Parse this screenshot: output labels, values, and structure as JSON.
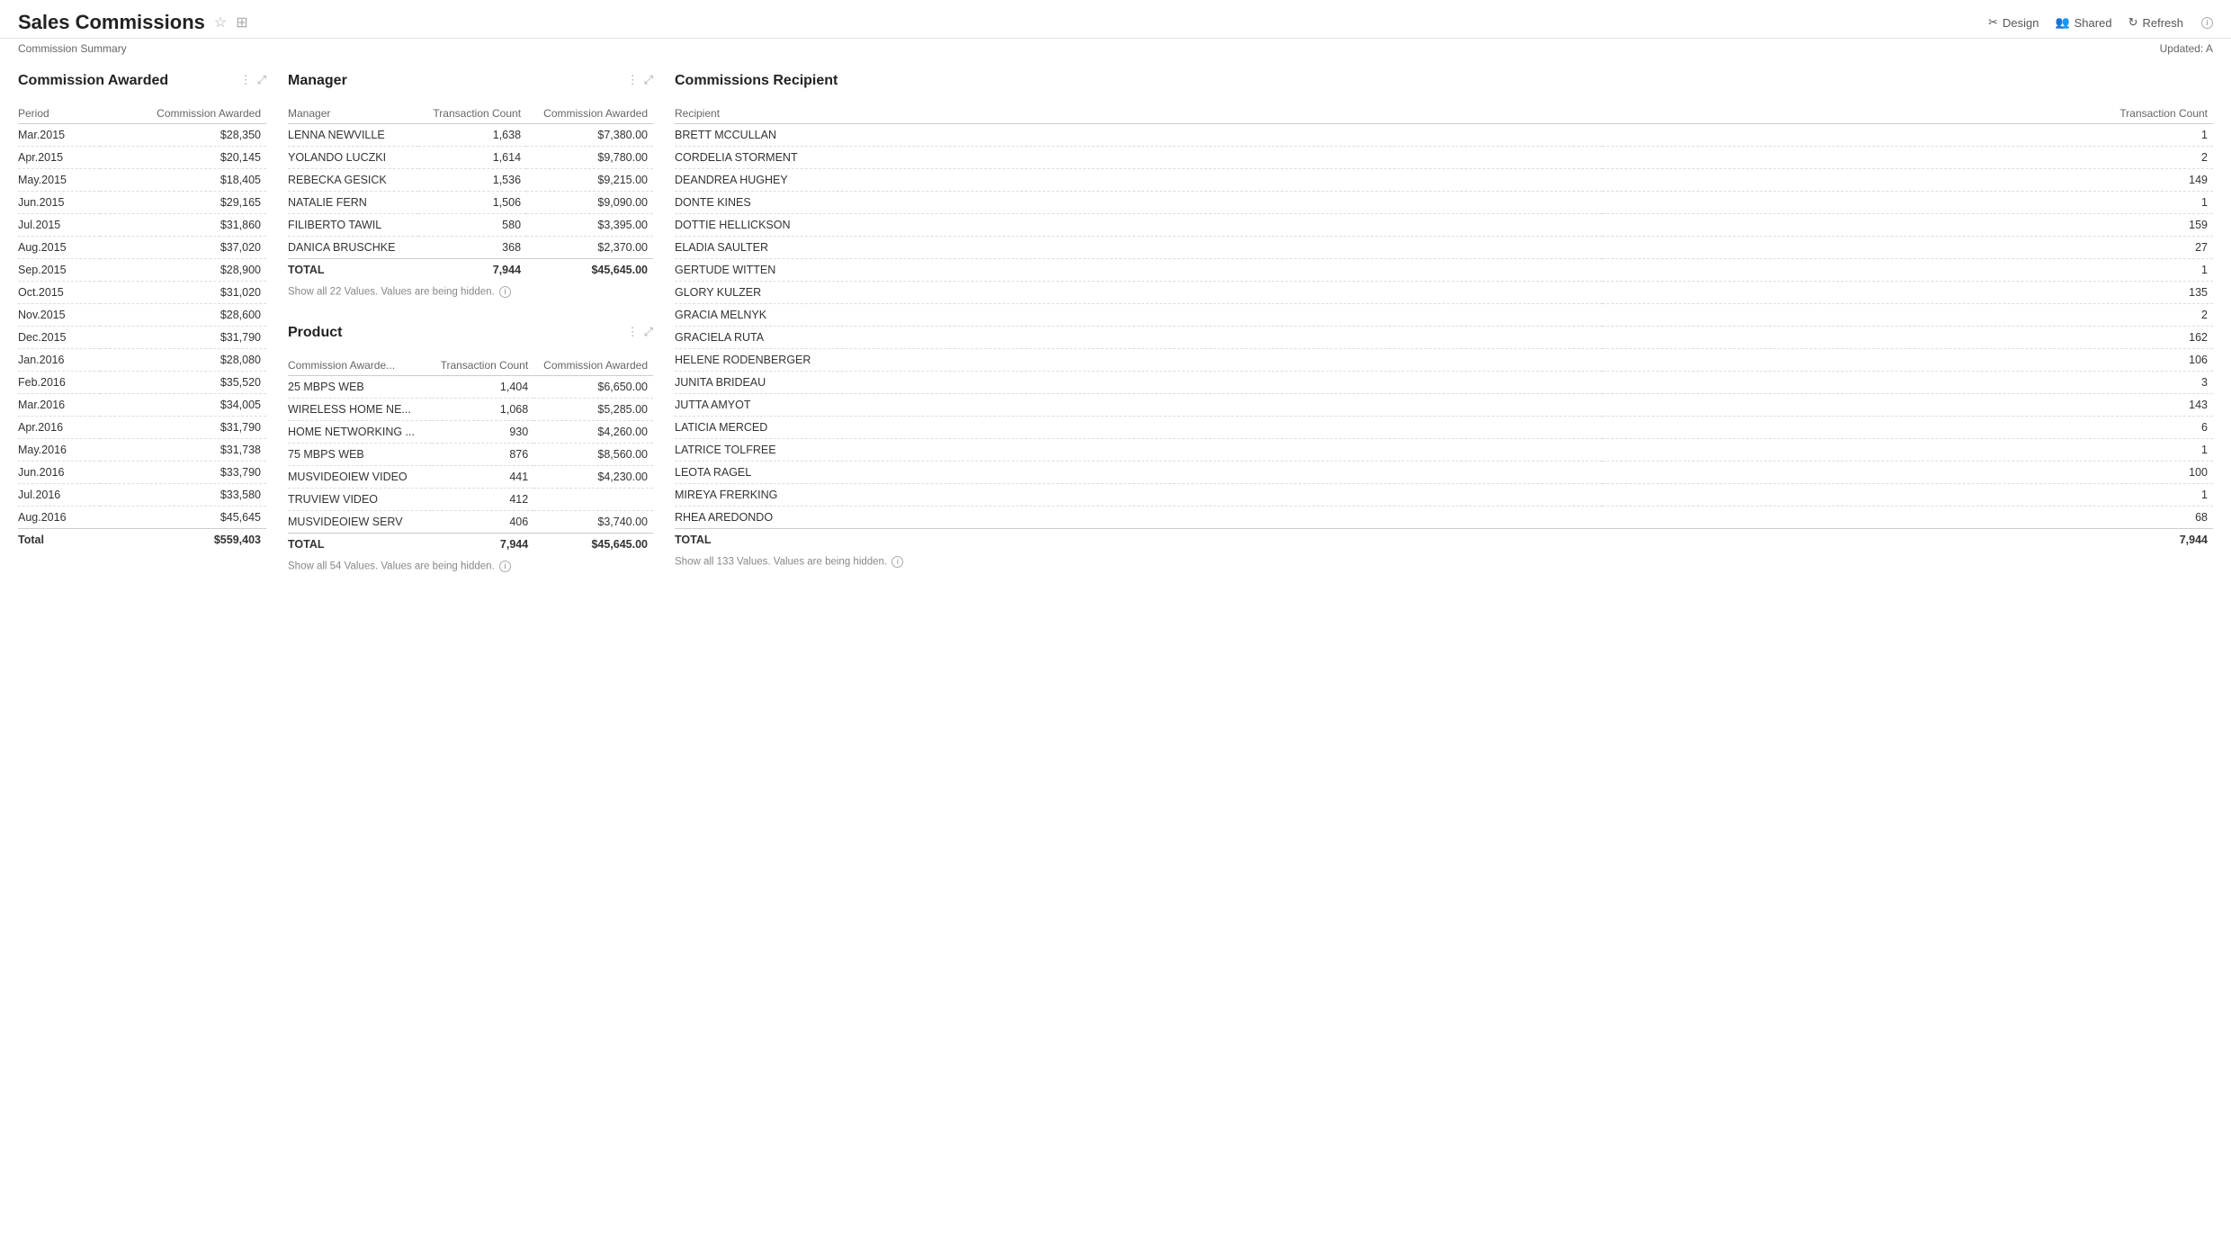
{
  "header": {
    "title": "Sales Commissions",
    "subtitle": "Commission Summary",
    "updated": "Updated: A",
    "actions": {
      "design": "Design",
      "shared": "Shared",
      "refresh": "Refresh"
    }
  },
  "commission_awarded": {
    "title": "Commission Awarded",
    "columns": [
      "Period",
      "Commission Awarded"
    ],
    "rows": [
      {
        "period": "Mar.2015",
        "amount": "$28,350"
      },
      {
        "period": "Apr.2015",
        "amount": "$20,145"
      },
      {
        "period": "May.2015",
        "amount": "$18,405"
      },
      {
        "period": "Jun.2015",
        "amount": "$29,165"
      },
      {
        "period": "Jul.2015",
        "amount": "$31,860"
      },
      {
        "period": "Aug.2015",
        "amount": "$37,020"
      },
      {
        "period": "Sep.2015",
        "amount": "$28,900"
      },
      {
        "period": "Oct.2015",
        "amount": "$31,020"
      },
      {
        "period": "Nov.2015",
        "amount": "$28,600"
      },
      {
        "period": "Dec.2015",
        "amount": "$31,790"
      },
      {
        "period": "Jan.2016",
        "amount": "$28,080"
      },
      {
        "period": "Feb.2016",
        "amount": "$35,520"
      },
      {
        "period": "Mar.2016",
        "amount": "$34,005"
      },
      {
        "period": "Apr.2016",
        "amount": "$31,790"
      },
      {
        "period": "May.2016",
        "amount": "$31,738"
      },
      {
        "period": "Jun.2016",
        "amount": "$33,790"
      },
      {
        "period": "Jul.2016",
        "amount": "$33,580"
      },
      {
        "period": "Aug.2016",
        "amount": "$45,645"
      }
    ],
    "total": {
      "period": "Total",
      "amount": "$559,403"
    }
  },
  "manager": {
    "title": "Manager",
    "columns": [
      "Manager",
      "Transaction Count",
      "Commission Awarded"
    ],
    "rows": [
      {
        "manager": "LENNA NEWVILLE",
        "count": "1,638",
        "amount": "$7,380.00"
      },
      {
        "manager": "YOLANDO LUCZKI",
        "count": "1,614",
        "amount": "$9,780.00"
      },
      {
        "manager": "REBECKA GESICK",
        "count": "1,536",
        "amount": "$9,215.00"
      },
      {
        "manager": "NATALIE FERN",
        "count": "1,506",
        "amount": "$9,090.00"
      },
      {
        "manager": "FILIBERTO TAWIL",
        "count": "580",
        "amount": "$3,395.00"
      },
      {
        "manager": "DANICA BRUSCHKE",
        "count": "368",
        "amount": "$2,370.00"
      }
    ],
    "total": {
      "manager": "TOTAL",
      "count": "7,944",
      "amount": "$45,645.00"
    },
    "show_all": "Show all 22 Values.",
    "hidden_note": "Values are being hidden."
  },
  "product": {
    "title": "Product",
    "columns": [
      "Commission Awarde...",
      "Transaction Count",
      "Commission Awarded"
    ],
    "rows": [
      {
        "product": "25 MBPS WEB",
        "count": "1,404",
        "amount": "$6,650.00"
      },
      {
        "product": "WIRELESS HOME NE...",
        "count": "1,068",
        "amount": "$5,285.00"
      },
      {
        "product": "HOME NETWORKING ...",
        "count": "930",
        "amount": "$4,260.00"
      },
      {
        "product": "75 MBPS WEB",
        "count": "876",
        "amount": "$8,560.00"
      },
      {
        "product": "MUSVIDEOIEW VIDEO",
        "count": "441",
        "amount": "$4,230.00"
      },
      {
        "product": "TRUVIEW VIDEO",
        "count": "412",
        "amount": ""
      },
      {
        "product": "MUSVIDEOIEW SERV",
        "count": "406",
        "amount": "$3,740.00"
      }
    ],
    "total": {
      "product": "TOTAL",
      "count": "7,944",
      "amount": "$45,645.00"
    },
    "show_all": "Show all 54 Values.",
    "hidden_note": "Values are being hidden."
  },
  "commissions_recipient": {
    "title": "Commissions Recipient",
    "columns": [
      "Recipient",
      "Transaction Count"
    ],
    "rows": [
      {
        "recipient": "BRETT MCCULLAN",
        "count": "1"
      },
      {
        "recipient": "CORDELIA STORMENT",
        "count": "2"
      },
      {
        "recipient": "DEANDREA HUGHEY",
        "count": "149"
      },
      {
        "recipient": "DONTE KINES",
        "count": "1"
      },
      {
        "recipient": "DOTTIE HELLICKSON",
        "count": "159"
      },
      {
        "recipient": "ELADIA SAULTER",
        "count": "27"
      },
      {
        "recipient": "GERTUDE WITTEN",
        "count": "1"
      },
      {
        "recipient": "GLORY KULZER",
        "count": "135"
      },
      {
        "recipient": "GRACIA MELNYK",
        "count": "2"
      },
      {
        "recipient": "GRACIELA RUTA",
        "count": "162"
      },
      {
        "recipient": "HELENE RODENBERGER",
        "count": "106"
      },
      {
        "recipient": "JUNITA BRIDEAU",
        "count": "3"
      },
      {
        "recipient": "JUTTA AMYOT",
        "count": "143"
      },
      {
        "recipient": "LATICIA MERCED",
        "count": "6"
      },
      {
        "recipient": "LATRICE TOLFREE",
        "count": "1"
      },
      {
        "recipient": "LEOTA RAGEL",
        "count": "100"
      },
      {
        "recipient": "MIREYA FRERKING",
        "count": "1"
      },
      {
        "recipient": "RHEA AREDONDO",
        "count": "68"
      }
    ],
    "total": {
      "recipient": "TOTAL",
      "count": "7,944"
    },
    "show_all": "Show all 133 Values.",
    "hidden_note": "Values are being hidden."
  }
}
